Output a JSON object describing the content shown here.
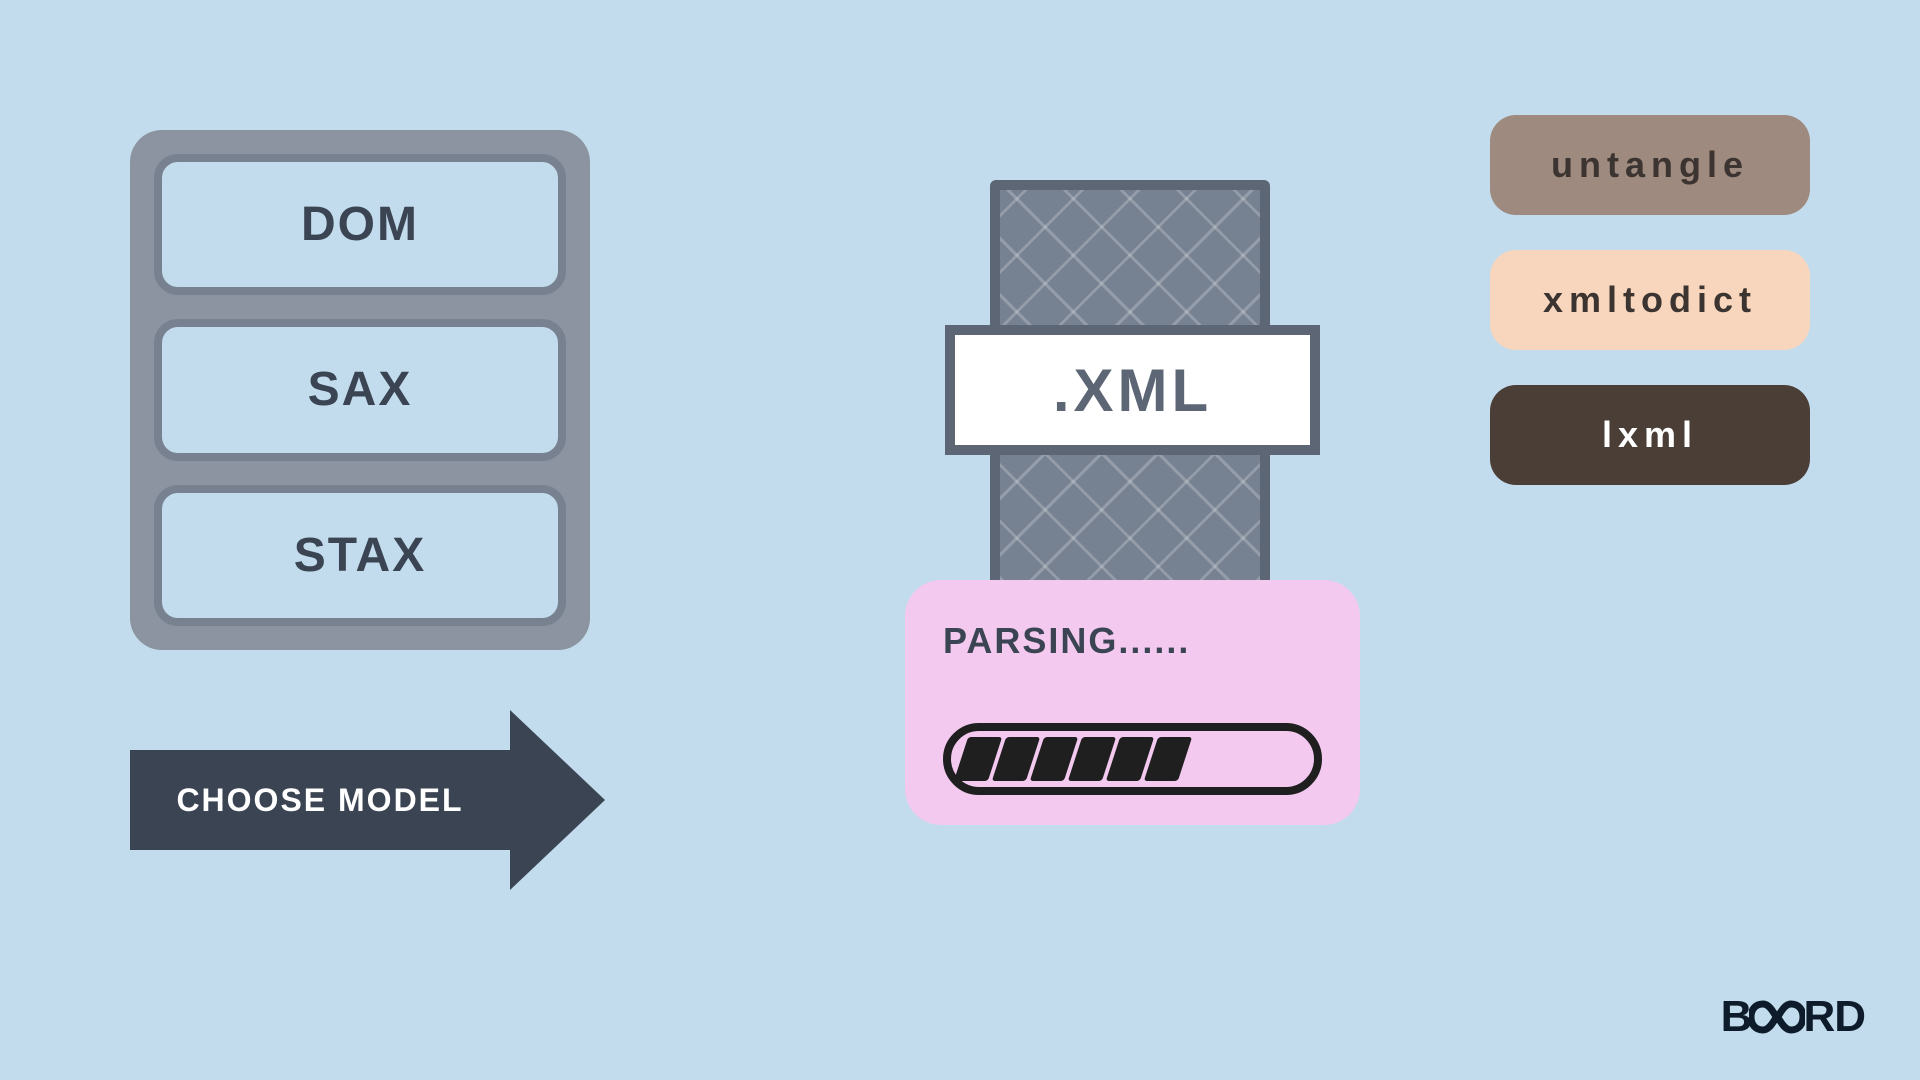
{
  "models": {
    "item1": "DOM",
    "item2": "SAX",
    "item3": "STAX"
  },
  "arrow": {
    "label": "CHOOSE MODEL"
  },
  "xml": {
    "extension": ".XML"
  },
  "parsing": {
    "label": "PARSING......"
  },
  "libs": {
    "l1": "untangle",
    "l2": "xmltodict",
    "l3": "lxml"
  },
  "logo": {
    "pre": "B",
    "post": "RD"
  }
}
